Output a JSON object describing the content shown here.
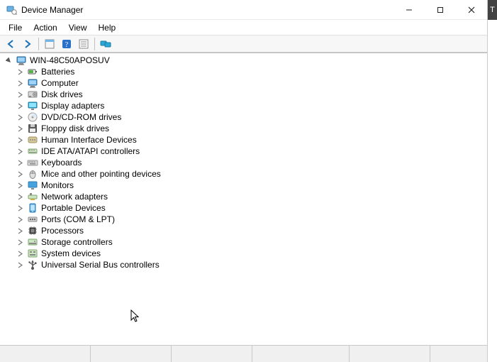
{
  "window": {
    "title": "Device Manager"
  },
  "menu": {
    "file": "File",
    "action": "Action",
    "view": "View",
    "help": "Help"
  },
  "tree": {
    "root": "WIN-48C50APOSUV",
    "items": [
      {
        "label": "Batteries",
        "icon": "battery"
      },
      {
        "label": "Computer",
        "icon": "computer"
      },
      {
        "label": "Disk drives",
        "icon": "disk"
      },
      {
        "label": "Display adapters",
        "icon": "display"
      },
      {
        "label": "DVD/CD-ROM drives",
        "icon": "optical"
      },
      {
        "label": "Floppy disk drives",
        "icon": "floppy"
      },
      {
        "label": "Human Interface Devices",
        "icon": "hid"
      },
      {
        "label": "IDE ATA/ATAPI controllers",
        "icon": "ide"
      },
      {
        "label": "Keyboards",
        "icon": "keyboard"
      },
      {
        "label": "Mice and other pointing devices",
        "icon": "mouse"
      },
      {
        "label": "Monitors",
        "icon": "monitor"
      },
      {
        "label": "Network adapters",
        "icon": "network"
      },
      {
        "label": "Portable Devices",
        "icon": "portable"
      },
      {
        "label": "Ports (COM & LPT)",
        "icon": "port"
      },
      {
        "label": "Processors",
        "icon": "cpu"
      },
      {
        "label": "Storage controllers",
        "icon": "storage"
      },
      {
        "label": "System devices",
        "icon": "system"
      },
      {
        "label": "Universal Serial Bus controllers",
        "icon": "usb"
      }
    ]
  },
  "right_strip": "T"
}
